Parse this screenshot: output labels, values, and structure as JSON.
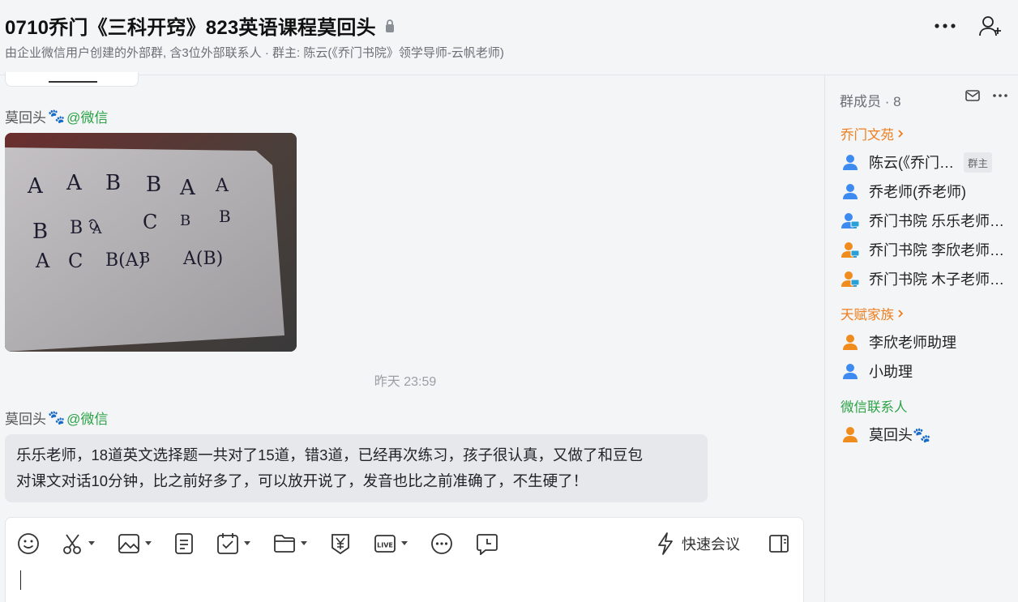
{
  "header": {
    "title": "0710乔门《三科开窍》823英语课程莫回头",
    "subtitle": "由企业微信用户创建的外部群, 含3位外部联系人 · 群主: 陈云(《乔门书院》领学导师-云帆老师)",
    "icons": [
      "lock-icon",
      "more-icon",
      "add-member-icon"
    ]
  },
  "chat": {
    "messages": [
      {
        "sender": "莫回头",
        "sender_emoji": "🐾",
        "source": "@微信",
        "type": "image",
        "image_text": [
          "A",
          "A",
          "B",
          "B",
          "A",
          "A",
          "B",
          "B",
          "A",
          "C",
          "B",
          "B",
          "A",
          "C",
          "B(A)",
          "B",
          "A(B)"
        ]
      },
      {
        "sender": "莫回头",
        "sender_emoji": "🐾",
        "source": "@微信",
        "type": "text",
        "text_line1": "乐乐老师，18道英文选择题一共对了15道，错3道，已经再次练习，孩子很认真，又做了和豆包",
        "text_line2": "对课文对话10分钟，比之前好多了，可以放开说了，发音也比之前准确了，不生硬了！"
      }
    ],
    "timestamp": "昨天 23:59"
  },
  "composer": {
    "tools": [
      "emoji-icon",
      "scissors-icon",
      "image-icon",
      "document-icon",
      "schedule-icon",
      "folder-icon",
      "payment-icon",
      "live-icon",
      "more-options-icon",
      "message-history-icon"
    ],
    "live_label": "LIVE",
    "quick_meeting_label": "快速会议"
  },
  "members": {
    "header": "群成员 · 8",
    "groups": [
      {
        "label": "乔门文苑",
        "color": "#ee7e1e",
        "items": [
          {
            "name": "陈云(《乔门书院》领学导师-云帆老师)",
            "badge": "群主",
            "avatar": "#3d8bf0"
          },
          {
            "name": "乔老师(乔老师)",
            "avatar": "#3d8bf0"
          },
          {
            "name": "乔门书院 乐乐老师(乔门书院)",
            "avatar": "#3d8bf0"
          },
          {
            "name": "乔门书院 李欣老师(乔门书院)",
            "avatar": "#f08c1e"
          },
          {
            "name": "乔门书院 木子老师(乔门书院)",
            "avatar": "#f08c1e"
          }
        ]
      },
      {
        "label": "天赋家族",
        "color": "#ee7e1e",
        "items": [
          {
            "name": "李欣老师助理",
            "avatar": "#f08c1e"
          },
          {
            "name": "小助理",
            "avatar": "#3d8bf0"
          }
        ]
      },
      {
        "label": "微信联系人",
        "color": "#2ba245",
        "items": [
          {
            "name": "莫回头🐾",
            "avatar": "#f08c1e"
          }
        ]
      }
    ]
  }
}
